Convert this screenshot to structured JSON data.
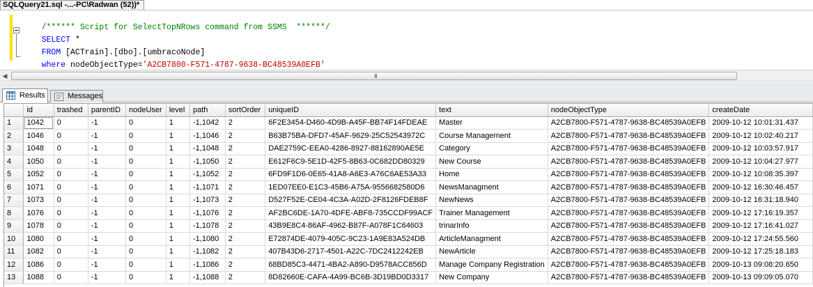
{
  "document_tab": {
    "title": "SQLQuery21.sql -...-PC\\Radwan (52))*"
  },
  "editor": {
    "line1": "/****** Script for SelectTopNRows command from SSMS  ******/",
    "line2_kw": "SELECT",
    "line2_rest": " *",
    "line3_kw": "FROM",
    "line3_rest": " [ACTrain].[dbo].[umbracoNode]",
    "line4_kw": "where",
    "line4_rest": " nodeObjectType=",
    "line4_str": "'A2CB7800-F571-4787-9638-BC48539A0EFB'"
  },
  "scrollbar": {
    "grip": "III"
  },
  "result_tabs": [
    {
      "label": "Results",
      "icon": "grid-icon",
      "active": true
    },
    {
      "label": "Messages",
      "icon": "messages-icon",
      "active": false
    }
  ],
  "grid": {
    "columns": [
      "id",
      "trashed",
      "parentID",
      "nodeUser",
      "level",
      "path",
      "sortOrder",
      "uniqueID",
      "text",
      "nodeObjectType",
      "createDate"
    ],
    "rows": [
      [
        "1",
        "1042",
        "0",
        "-1",
        "0",
        "1",
        "-1,1042",
        "2",
        "6F2E3454-D460-4D9B-A45F-BB74F14FDEAE",
        "Master",
        "A2CB7800-F571-4787-9638-BC48539A0EFB",
        "2009-10-12 10:01:31.437"
      ],
      [
        "2",
        "1046",
        "0",
        "-1",
        "0",
        "1",
        "-1,1046",
        "2",
        "B63B75BA-DFD7-45AF-9629-25C52543972C",
        "Course Management",
        "A2CB7800-F571-4787-9638-BC48539A0EFB",
        "2009-10-12 10:02:40.217"
      ],
      [
        "3",
        "1048",
        "0",
        "-1",
        "0",
        "1",
        "-1,1048",
        "2",
        "DAE2759C-EEA0-4286-8927-88162890AE5E",
        "Category",
        "A2CB7800-F571-4787-9638-BC48539A0EFB",
        "2009-10-12 10:03:57.917"
      ],
      [
        "4",
        "1050",
        "0",
        "-1",
        "0",
        "1",
        "-1,1050",
        "2",
        "E612F6C9-5E1D-42F5-8B63-0C682DD80329",
        "New Course",
        "A2CB7800-F571-4787-9638-BC48539A0EFB",
        "2009-10-12 10:04:27.977"
      ],
      [
        "5",
        "1052",
        "0",
        "-1",
        "0",
        "1",
        "-1,1052",
        "2",
        "6FD9F1D6-0E65-41A8-A6E3-A76C6AE53A33",
        "Home",
        "A2CB7800-F571-4787-9638-BC48539A0EFB",
        "2009-10-12 10:08:35.397"
      ],
      [
        "6",
        "1071",
        "0",
        "-1",
        "0",
        "1",
        "-1,1071",
        "2",
        "1ED07EE0-E1C3-45B6-A75A-9556682580D6",
        "NewsManagment",
        "A2CB7800-F571-4787-9638-BC48539A0EFB",
        "2009-10-12 16:30:46.457"
      ],
      [
        "7",
        "1073",
        "0",
        "-1",
        "0",
        "1",
        "-1,1073",
        "2",
        "D527F52E-CE04-4C3A-A02D-2F8126FDEB8F",
        "NewNews",
        "A2CB7800-F571-4787-9638-BC48539A0EFB",
        "2009-10-12 16:31:18.940"
      ],
      [
        "8",
        "1076",
        "0",
        "-1",
        "0",
        "1",
        "-1,1076",
        "2",
        "AF2BC6DE-1A70-4DFE-ABF8-735CCDF99ACF",
        "Trainer Management",
        "A2CB7800-F571-4787-9638-BC48539A0EFB",
        "2009-10-12 17:16:19.357"
      ],
      [
        "9",
        "1078",
        "0",
        "-1",
        "0",
        "1",
        "-1,1078",
        "2",
        "43B9E8C4-86AF-4962-B87F-A078F1C64603",
        "trinarInfo",
        "A2CB7800-F571-4787-9638-BC48539A0EFB",
        "2009-10-12 17:16:41.027"
      ],
      [
        "10",
        "1080",
        "0",
        "-1",
        "0",
        "1",
        "-1,1080",
        "2",
        "E72874DE-4079-405C-9C23-1A9E83A524DB",
        "ArticleManagment",
        "A2CB7800-F571-4787-9638-BC48539A0EFB",
        "2009-10-12 17:24:55.560"
      ],
      [
        "11",
        "1082",
        "0",
        "-1",
        "0",
        "1",
        "-1,1082",
        "2",
        "407B43D6-2717-4501-A22C-7DC2412242EB",
        "NewArticle",
        "A2CB7800-F571-4787-9638-BC48539A0EFB",
        "2009-10-12 17:25:18.183"
      ],
      [
        "12",
        "1086",
        "0",
        "-1",
        "0",
        "1",
        "-1,1086",
        "2",
        "68BD85C3-4471-4BA2-A890-D9578ACC856D",
        "Manage Company Registration",
        "A2CB7800-F571-4787-9638-BC48539A0EFB",
        "2009-10-13 09:08:20.650"
      ],
      [
        "13",
        "1088",
        "0",
        "-1",
        "0",
        "1",
        "-1,1088",
        "2",
        "8D82660E-CAFA-4A99-BC6B-3D19BD0D3317",
        "New Company",
        "A2CB7800-F571-4787-9638-BC48539A0EFB",
        "2009-10-13 09:09:05.070"
      ]
    ]
  }
}
